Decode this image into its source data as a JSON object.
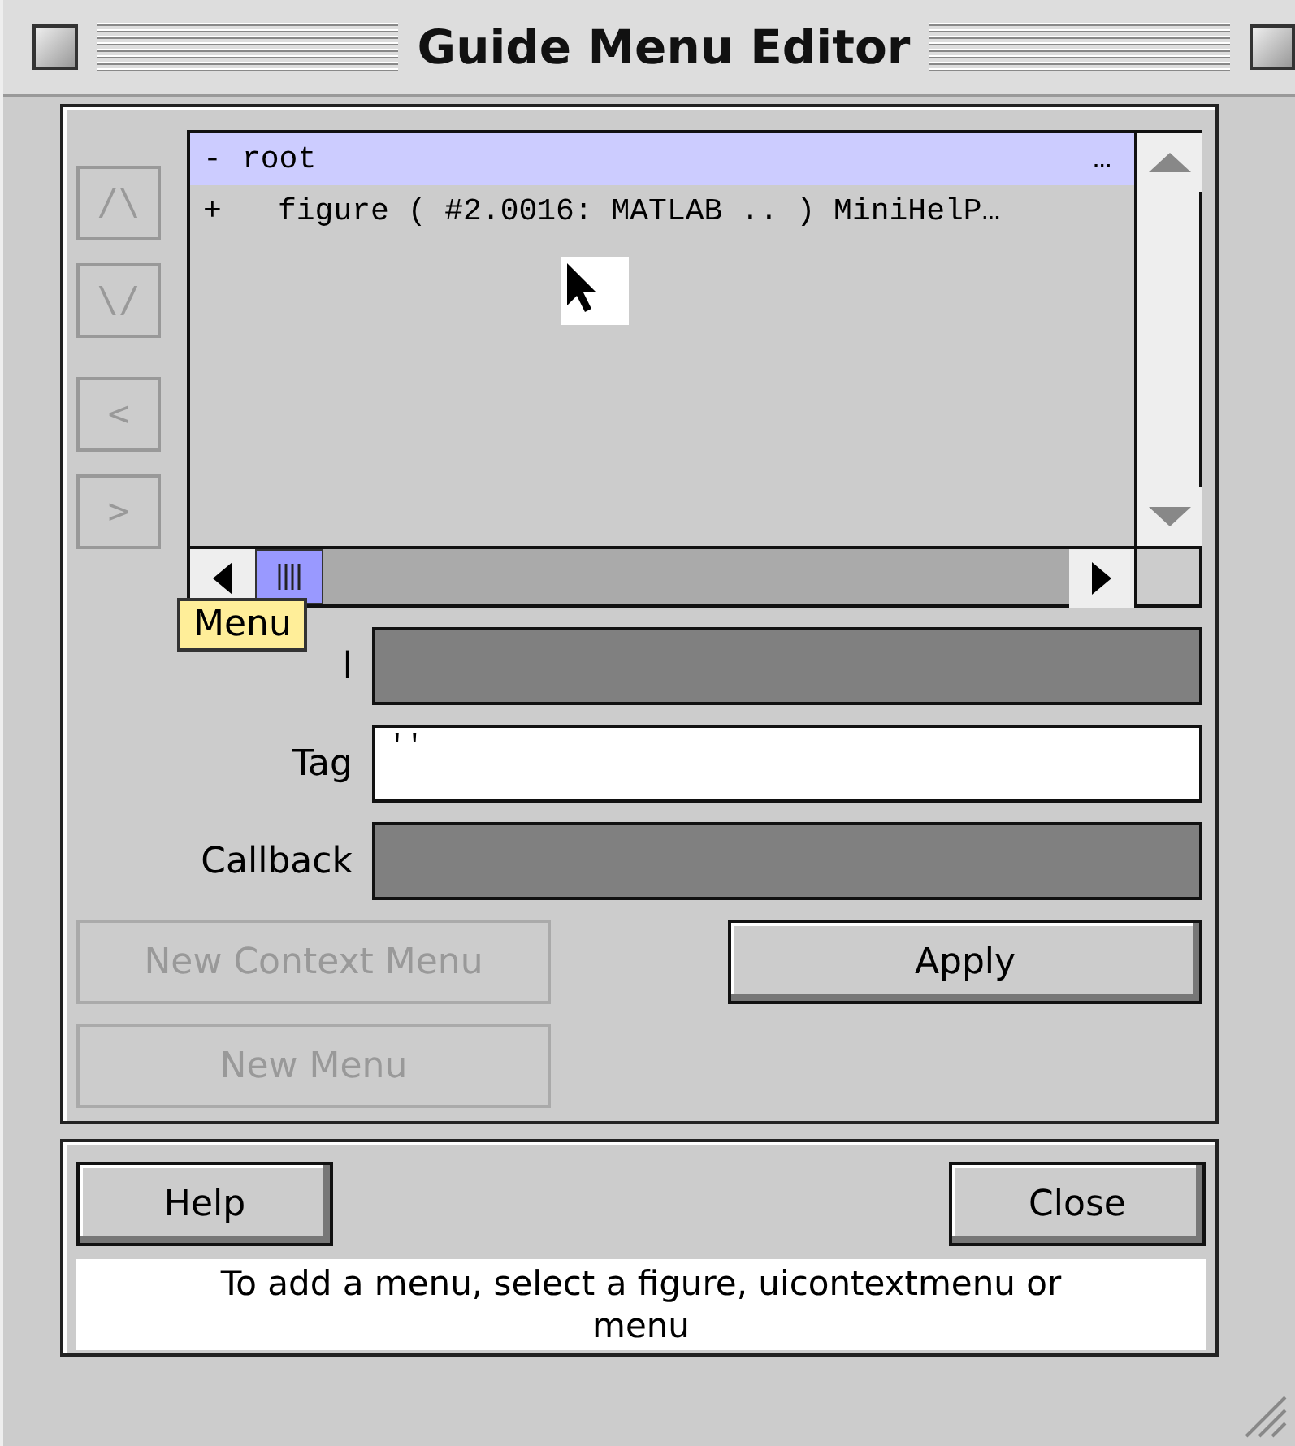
{
  "window": {
    "title": "Guide Menu Editor"
  },
  "nav_buttons": [
    {
      "label": "/\\",
      "disabled": true
    },
    {
      "label": "\\/",
      "disabled": true
    },
    {
      "label": "<",
      "disabled": true
    },
    {
      "label": ">",
      "disabled": true
    }
  ],
  "tree": [
    {
      "toggle": "-",
      "label": "root",
      "trail": "…",
      "selected": true,
      "children": [
        {
          "toggle": "+",
          "label": "figure ( #2.0016: MATLAB .. ) MiniHelP…",
          "selected": false
        }
      ]
    }
  ],
  "tooltip": {
    "text": "Menu"
  },
  "fields": [
    {
      "label": "l",
      "disabled": true
    },
    {
      "label": "Tag",
      "value": "''",
      "disabled": false
    },
    {
      "label": "Callback",
      "disabled": true
    }
  ],
  "buttons": [
    {
      "label": "New Context Menu",
      "disabled": true
    },
    {
      "label": "Apply",
      "disabled": false
    },
    {
      "label": "New Menu",
      "disabled": true
    }
  ],
  "footer": {
    "help": "Help",
    "close": "Close",
    "status": "To add a menu, select a figure, uicontextmenu or menu"
  }
}
